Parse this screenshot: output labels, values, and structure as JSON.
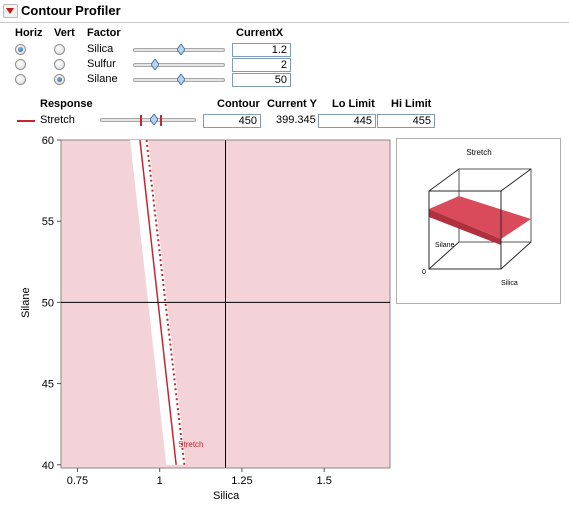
{
  "window": {
    "title": "Contour Profiler"
  },
  "factor_table": {
    "headers": {
      "horiz": "Horiz",
      "vert": "Vert",
      "factor": "Factor",
      "current_x": "CurrentX"
    },
    "rows": [
      {
        "name": "Silica",
        "value": "1.2",
        "horiz_selected": true,
        "vert_selected": false,
        "slider_fraction": 0.5
      },
      {
        "name": "Sulfur",
        "value": "2",
        "horiz_selected": false,
        "vert_selected": false,
        "slider_fraction": 0.2
      },
      {
        "name": "Silane",
        "value": "50",
        "horiz_selected": false,
        "vert_selected": true,
        "slider_fraction": 0.5
      }
    ]
  },
  "response_table": {
    "headers": {
      "response": "Response",
      "contour": "Contour",
      "current_y": "Current Y",
      "lo_limit": "Lo Limit",
      "hi_limit": "Hi Limit"
    },
    "rows": [
      {
        "name": "Stretch",
        "contour": "450",
        "current_y": "399.345",
        "lo_limit": "445",
        "hi_limit": "455",
        "color": "#c8262f"
      }
    ]
  },
  "chart_data": {
    "type": "contour",
    "xlabel": "Silica",
    "ylabel": "Silane",
    "x_ticks": [
      "0.75",
      "1",
      "1.25",
      "1.5"
    ],
    "y_ticks": [
      "40",
      "45",
      "50",
      "55",
      "60"
    ],
    "xlim": [
      0.7,
      1.7
    ],
    "ylim": [
      39.8,
      60
    ],
    "current_x": 1.2,
    "current_y": 50,
    "contour_label": "Stretch",
    "contour_value": 450,
    "contour_line": [
      [
        1.05,
        40
      ],
      [
        0.94,
        60
      ]
    ],
    "hi_limit_line": [
      [
        1.02,
        40
      ],
      [
        0.91,
        60
      ]
    ],
    "lo_limit_line": [
      [
        1.08,
        40
      ],
      [
        0.965,
        60
      ]
    ],
    "shaded_color": "#f4d3d8",
    "contour_color": "#c8262f",
    "surface_plot": {
      "title": "Stretch",
      "axis_labels": {
        "x": "Silica",
        "y": "Silane",
        "origin": "0"
      },
      "surface_color": "#d94a5b"
    }
  }
}
